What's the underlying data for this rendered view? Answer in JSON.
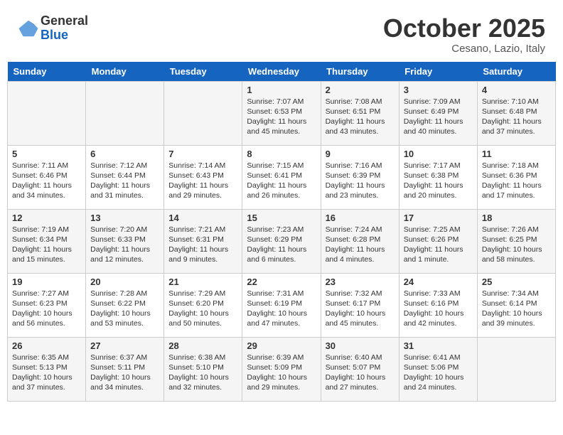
{
  "header": {
    "logo_general": "General",
    "logo_blue": "Blue",
    "month_title": "October 2025",
    "location": "Cesano, Lazio, Italy"
  },
  "weekdays": [
    "Sunday",
    "Monday",
    "Tuesday",
    "Wednesday",
    "Thursday",
    "Friday",
    "Saturday"
  ],
  "weeks": [
    [
      {
        "day": "",
        "info": ""
      },
      {
        "day": "",
        "info": ""
      },
      {
        "day": "",
        "info": ""
      },
      {
        "day": "1",
        "info": "Sunrise: 7:07 AM\nSunset: 6:53 PM\nDaylight: 11 hours\nand 45 minutes."
      },
      {
        "day": "2",
        "info": "Sunrise: 7:08 AM\nSunset: 6:51 PM\nDaylight: 11 hours\nand 43 minutes."
      },
      {
        "day": "3",
        "info": "Sunrise: 7:09 AM\nSunset: 6:49 PM\nDaylight: 11 hours\nand 40 minutes."
      },
      {
        "day": "4",
        "info": "Sunrise: 7:10 AM\nSunset: 6:48 PM\nDaylight: 11 hours\nand 37 minutes."
      }
    ],
    [
      {
        "day": "5",
        "info": "Sunrise: 7:11 AM\nSunset: 6:46 PM\nDaylight: 11 hours\nand 34 minutes."
      },
      {
        "day": "6",
        "info": "Sunrise: 7:12 AM\nSunset: 6:44 PM\nDaylight: 11 hours\nand 31 minutes."
      },
      {
        "day": "7",
        "info": "Sunrise: 7:14 AM\nSunset: 6:43 PM\nDaylight: 11 hours\nand 29 minutes."
      },
      {
        "day": "8",
        "info": "Sunrise: 7:15 AM\nSunset: 6:41 PM\nDaylight: 11 hours\nand 26 minutes."
      },
      {
        "day": "9",
        "info": "Sunrise: 7:16 AM\nSunset: 6:39 PM\nDaylight: 11 hours\nand 23 minutes."
      },
      {
        "day": "10",
        "info": "Sunrise: 7:17 AM\nSunset: 6:38 PM\nDaylight: 11 hours\nand 20 minutes."
      },
      {
        "day": "11",
        "info": "Sunrise: 7:18 AM\nSunset: 6:36 PM\nDaylight: 11 hours\nand 17 minutes."
      }
    ],
    [
      {
        "day": "12",
        "info": "Sunrise: 7:19 AM\nSunset: 6:34 PM\nDaylight: 11 hours\nand 15 minutes."
      },
      {
        "day": "13",
        "info": "Sunrise: 7:20 AM\nSunset: 6:33 PM\nDaylight: 11 hours\nand 12 minutes."
      },
      {
        "day": "14",
        "info": "Sunrise: 7:21 AM\nSunset: 6:31 PM\nDaylight: 11 hours\nand 9 minutes."
      },
      {
        "day": "15",
        "info": "Sunrise: 7:23 AM\nSunset: 6:29 PM\nDaylight: 11 hours\nand 6 minutes."
      },
      {
        "day": "16",
        "info": "Sunrise: 7:24 AM\nSunset: 6:28 PM\nDaylight: 11 hours\nand 4 minutes."
      },
      {
        "day": "17",
        "info": "Sunrise: 7:25 AM\nSunset: 6:26 PM\nDaylight: 11 hours\nand 1 minute."
      },
      {
        "day": "18",
        "info": "Sunrise: 7:26 AM\nSunset: 6:25 PM\nDaylight: 10 hours\nand 58 minutes."
      }
    ],
    [
      {
        "day": "19",
        "info": "Sunrise: 7:27 AM\nSunset: 6:23 PM\nDaylight: 10 hours\nand 56 minutes."
      },
      {
        "day": "20",
        "info": "Sunrise: 7:28 AM\nSunset: 6:22 PM\nDaylight: 10 hours\nand 53 minutes."
      },
      {
        "day": "21",
        "info": "Sunrise: 7:29 AM\nSunset: 6:20 PM\nDaylight: 10 hours\nand 50 minutes."
      },
      {
        "day": "22",
        "info": "Sunrise: 7:31 AM\nSunset: 6:19 PM\nDaylight: 10 hours\nand 47 minutes."
      },
      {
        "day": "23",
        "info": "Sunrise: 7:32 AM\nSunset: 6:17 PM\nDaylight: 10 hours\nand 45 minutes."
      },
      {
        "day": "24",
        "info": "Sunrise: 7:33 AM\nSunset: 6:16 PM\nDaylight: 10 hours\nand 42 minutes."
      },
      {
        "day": "25",
        "info": "Sunrise: 7:34 AM\nSunset: 6:14 PM\nDaylight: 10 hours\nand 39 minutes."
      }
    ],
    [
      {
        "day": "26",
        "info": "Sunrise: 6:35 AM\nSunset: 5:13 PM\nDaylight: 10 hours\nand 37 minutes."
      },
      {
        "day": "27",
        "info": "Sunrise: 6:37 AM\nSunset: 5:11 PM\nDaylight: 10 hours\nand 34 minutes."
      },
      {
        "day": "28",
        "info": "Sunrise: 6:38 AM\nSunset: 5:10 PM\nDaylight: 10 hours\nand 32 minutes."
      },
      {
        "day": "29",
        "info": "Sunrise: 6:39 AM\nSunset: 5:09 PM\nDaylight: 10 hours\nand 29 minutes."
      },
      {
        "day": "30",
        "info": "Sunrise: 6:40 AM\nSunset: 5:07 PM\nDaylight: 10 hours\nand 27 minutes."
      },
      {
        "day": "31",
        "info": "Sunrise: 6:41 AM\nSunset: 5:06 PM\nDaylight: 10 hours\nand 24 minutes."
      },
      {
        "day": "",
        "info": ""
      }
    ]
  ]
}
